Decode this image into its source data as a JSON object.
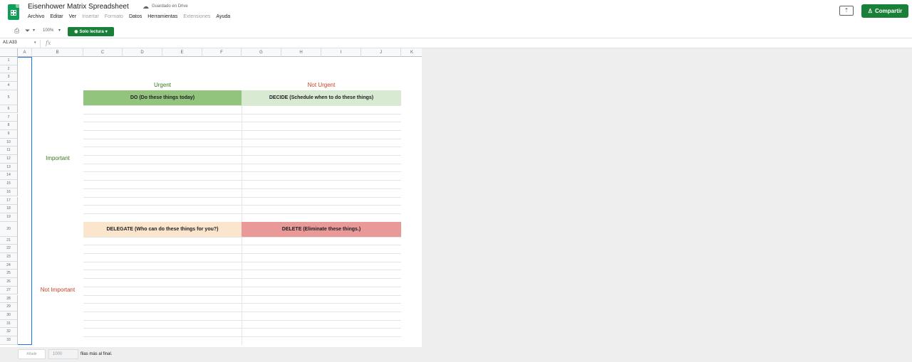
{
  "app": {
    "title": "Eisenhower Matrix Spreadsheet",
    "save_status": "Guardado en Drive",
    "share_label": "Compartir",
    "present_icon": "present-icon",
    "colors": {
      "brand_green": "#188038",
      "sheets_green": "#0f9d58"
    }
  },
  "menu": [
    {
      "label": "Archivo",
      "disabled": false
    },
    {
      "label": "Editar",
      "disabled": false
    },
    {
      "label": "Ver",
      "disabled": false
    },
    {
      "label": "Insertar",
      "disabled": true
    },
    {
      "label": "Formato",
      "disabled": true
    },
    {
      "label": "Datos",
      "disabled": false
    },
    {
      "label": "Herramientas",
      "disabled": false
    },
    {
      "label": "Extensiones",
      "disabled": true
    },
    {
      "label": "Ayuda",
      "disabled": false
    }
  ],
  "toolbar": {
    "zoom": "100%",
    "readonly_label": "Solo lectura"
  },
  "formula": {
    "name_box": "A1:A33",
    "fx_label": "fx"
  },
  "grid": {
    "columns": [
      "A",
      "B",
      "C",
      "D",
      "E",
      "F",
      "G",
      "H",
      "I",
      "J",
      "K"
    ],
    "row_count": 33
  },
  "matrix": {
    "urgent_label": "Urgent",
    "not_urgent_label": "Not Urgent",
    "important_label": "Important",
    "not_important_label": "Not Important",
    "do": {
      "label": "DO (Do these things today)",
      "color": "#93c47d"
    },
    "decide": {
      "label": "DECIDE (Schedule when to do these things)",
      "color": "#d9ead3"
    },
    "delegate": {
      "label": "DELEGATE (Who can do these things for you?)",
      "color": "#fce5cd"
    },
    "delete": {
      "label": "DELETE (Eliminate these things.)",
      "color": "#ea9999"
    },
    "green_text": "#38761d",
    "red_text": "#cc4125"
  },
  "footer": {
    "add_label": "Añadir",
    "rows_value": "1000",
    "rows_suffix": "filas más al final."
  }
}
